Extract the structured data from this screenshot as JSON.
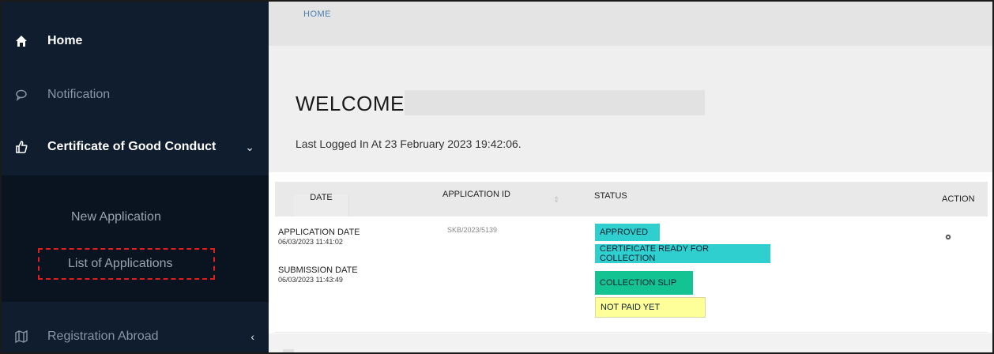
{
  "sidebar": {
    "items": [
      {
        "label": "Home",
        "icon": "home-icon"
      },
      {
        "label": "Notification",
        "icon": "chat-bubble-icon"
      },
      {
        "label": "Certificate of Good Conduct",
        "icon": "thumbs-up-icon",
        "chevron": "⌄"
      },
      {
        "label": "Registration Abroad",
        "icon": "map-icon",
        "chevron": "‹"
      }
    ],
    "submenu": [
      {
        "label": "New Application"
      },
      {
        "label": "List of Applications"
      }
    ]
  },
  "breadcrumb": "HOME",
  "welcome": {
    "title": "WELCOME,",
    "last_login": "Last Logged In At 23 February 2023 19:42:06."
  },
  "table": {
    "headers": {
      "date": "DATE",
      "app_id": "APPLICATION ID",
      "status": "STATUS",
      "action": "ACTION"
    },
    "row": {
      "application_date_label": "APPLICATION DATE",
      "application_date": "06/03/2023 11:41:02",
      "submission_date_label": "SUBMISSION DATE",
      "submission_date": "06/03/2023 11:43:49",
      "app_id": "SKB/2023/5139",
      "statuses": {
        "approved": "APPROVED",
        "ready": "CERTIFICATE READY FOR COLLECTION",
        "slip": "COLLECTION SLIP",
        "not_paid": "NOT PAID YET"
      }
    }
  },
  "colors": {
    "sidebar_bg": "#0f1d2e",
    "approved": "#2fcfcf",
    "slip": "#13c492",
    "not_paid": "#ffff99",
    "highlight_border": "#e01e1e"
  }
}
